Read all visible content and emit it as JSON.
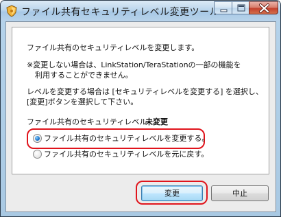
{
  "window": {
    "title": "ファイル共有セキュリティレベル変更ツール"
  },
  "icons": {
    "app": "shield-tool-icon",
    "minimize": "minimize-icon",
    "maximize": "maximize-icon",
    "close": "close-icon"
  },
  "content": {
    "intro": "ファイル共有のセキュリティレベルを変更します。",
    "note_line1": "※変更しない場合は、LinkStation/TeraStationの一部の機能を",
    "note_line2": "利用することができません。",
    "instruction_line1": "レベルを変更する場合は [セキュリティレベルを変更する] を選択し、",
    "instruction_line2": "[変更]ボタンを選択して下さい。",
    "status_label": "ファイル共有のセキュリティレベル ：",
    "status_value": "未変更"
  },
  "options": {
    "change": {
      "label": "ファイル共有のセキュリティレベルを変更する。",
      "selected": true
    },
    "revert": {
      "label": "ファイル共有のセキュリティレベルを元に戻す。",
      "selected": false
    }
  },
  "buttons": {
    "change": "変更",
    "cancel": "中止"
  },
  "colors": {
    "highlight": "#e0141c",
    "radio_selected": "#1a73c9"
  }
}
